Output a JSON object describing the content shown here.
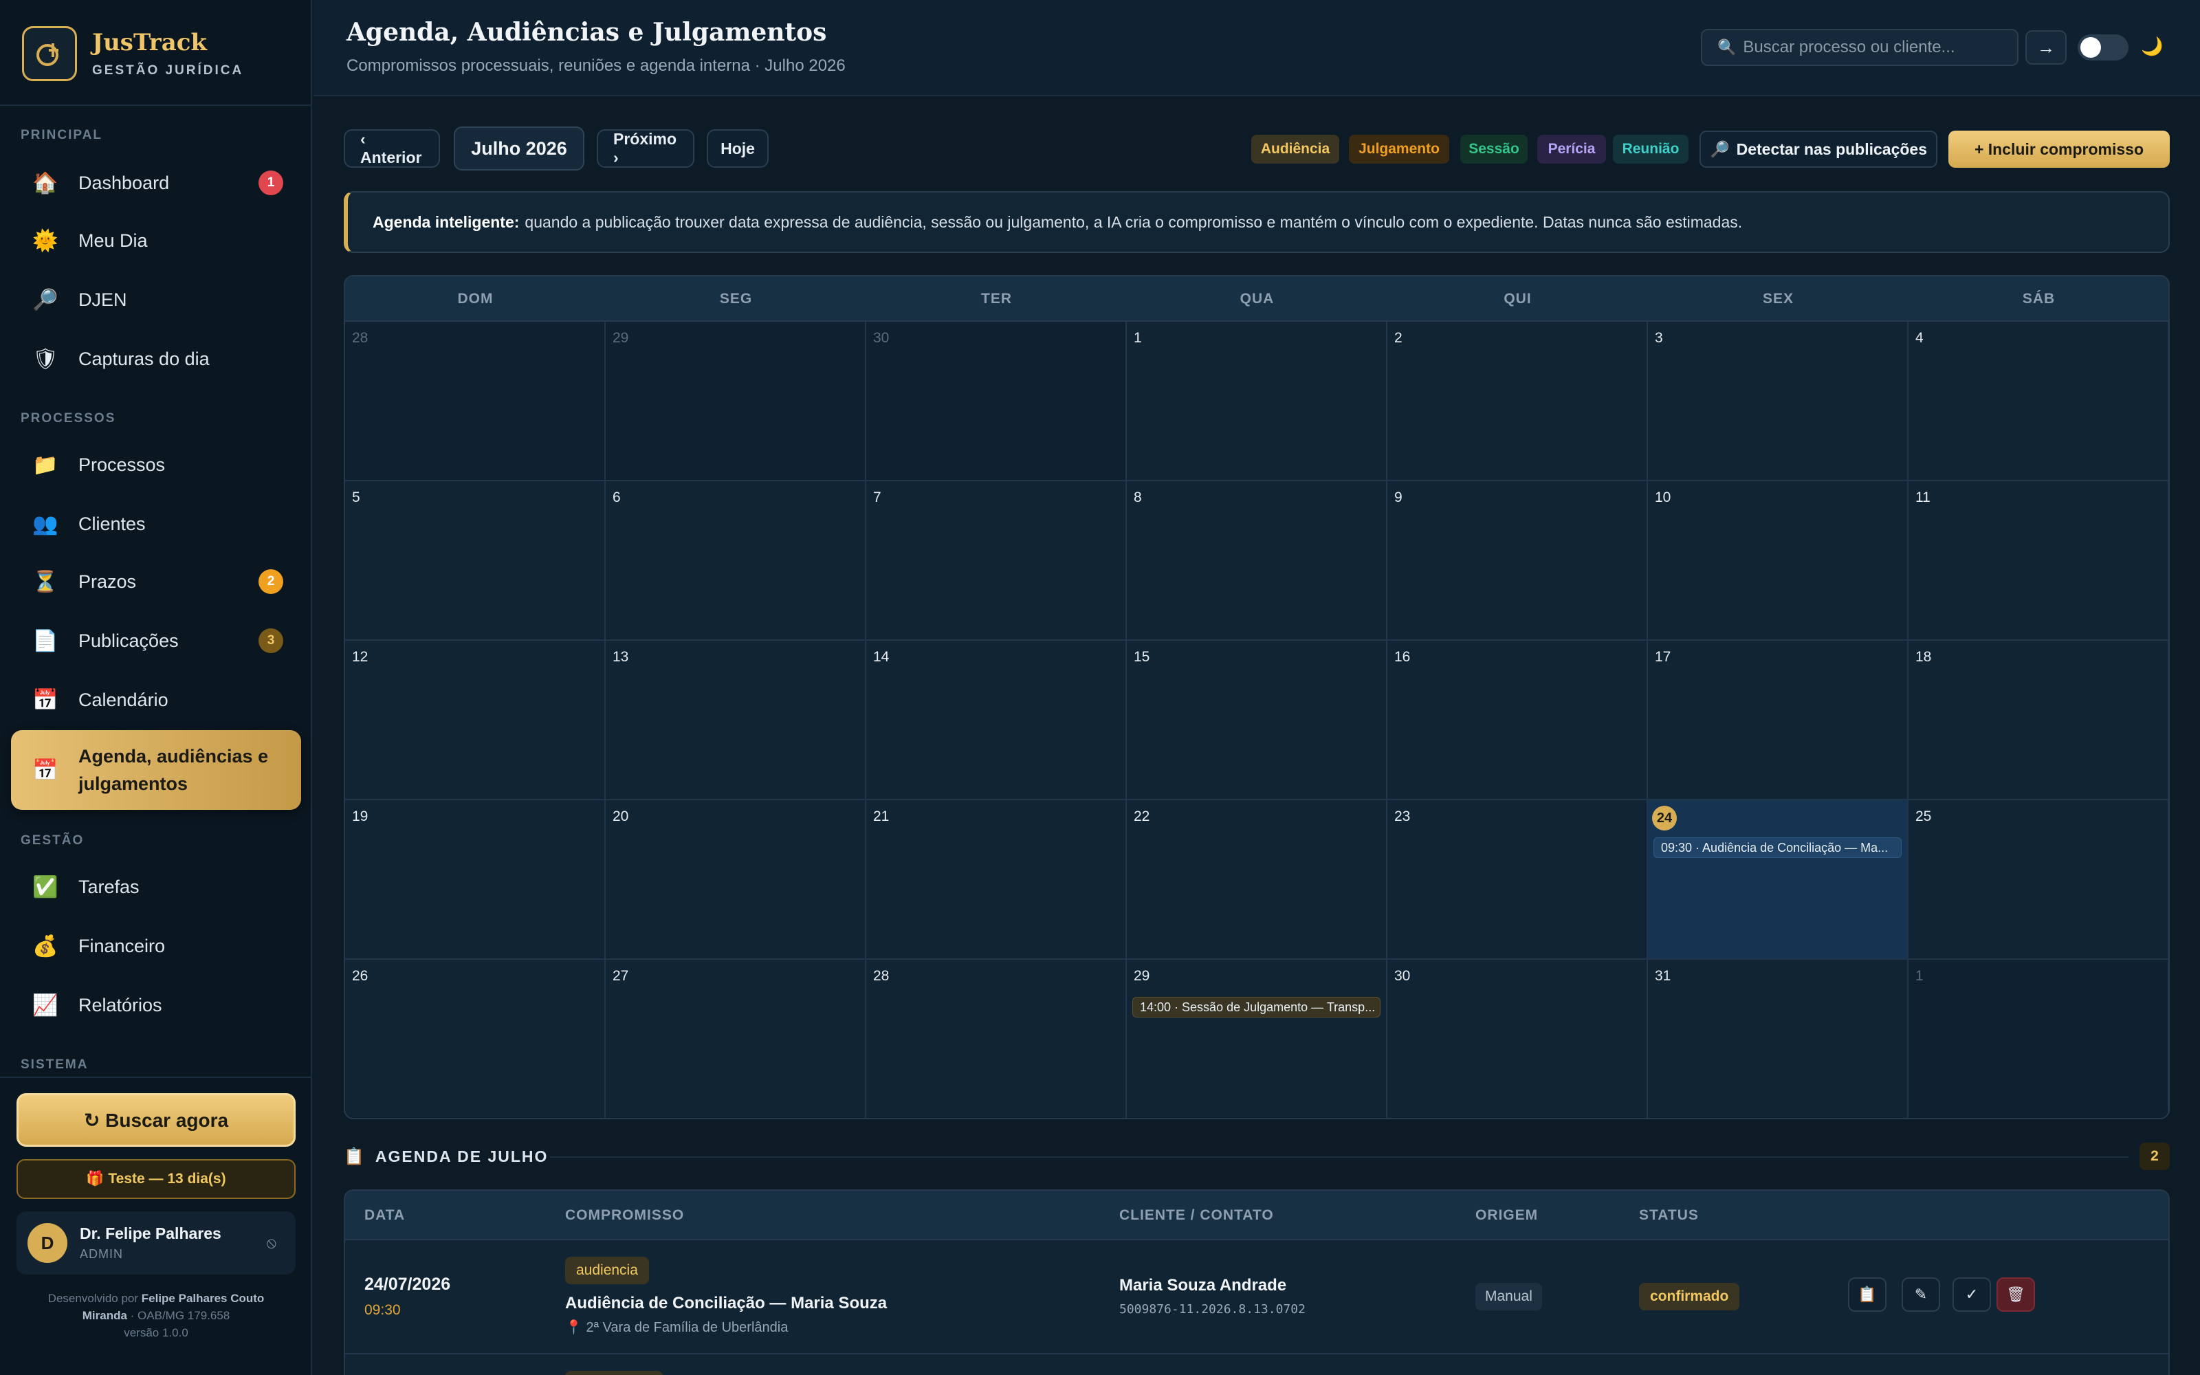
{
  "app": {
    "name": "JusTrack",
    "subtitle": "GESTÃO JURÍDICA"
  },
  "colors": {
    "accent_gold": "#d8ae55",
    "background": "#0d1b27",
    "sidebar": "#0a1620",
    "badge_red": "#e0474f",
    "badge_orange": "#f0a020"
  },
  "sidebar": {
    "sections": {
      "principal": "PRINCIPAL",
      "processos": "PROCESSOS",
      "gestao": "GESTÃO",
      "sistema": "SISTEMA"
    },
    "items": [
      {
        "label": "Dashboard",
        "icon": "home-icon",
        "badge": "1"
      },
      {
        "label": "Meu Dia",
        "icon": "sun-icon"
      },
      {
        "label": "DJEN",
        "icon": "magnifier-icon"
      },
      {
        "label": "Capturas do dia",
        "icon": "shield-icon"
      },
      {
        "label": "Processos",
        "icon": "folder-icon"
      },
      {
        "label": "Clientes",
        "icon": "users-icon"
      },
      {
        "label": "Prazos",
        "icon": "hourglass-icon",
        "badge": "2"
      },
      {
        "label": "Publicações",
        "icon": "document-icon",
        "badge": "3"
      },
      {
        "label": "Calendário",
        "icon": "calendar-icon"
      },
      {
        "label": "Agenda, audiências e julgamentos",
        "icon": "calendar-icon",
        "active": true
      },
      {
        "label": "Tarefas",
        "icon": "checkbox-icon"
      },
      {
        "label": "Financeiro",
        "icon": "money-bag-icon"
      },
      {
        "label": "Relatórios",
        "icon": "chart-icon"
      }
    ],
    "buscar_label": "↻ Buscar agora",
    "trial_label": "🎁 Teste — 13 dia(s)",
    "user": {
      "initial": "D",
      "name": "Dr. Felipe Palhares",
      "role": "ADMIN"
    },
    "credits": {
      "prefix": "Desenvolvido por",
      "author": "Felipe Palhares Couto Miranda",
      "oab": "· OAB/MG 179.658",
      "version": "versão 1.0.0"
    }
  },
  "header": {
    "title": "Agenda, Audiências e Julgamentos",
    "subtitle": "Compromissos processuais, reuniões e agenda interna · Julho 2026",
    "search_placeholder": "Buscar processo ou cliente...",
    "go_label": "→"
  },
  "toolbar": {
    "prev_label": "‹ Anterior",
    "month_label": "Julho 2026",
    "next_label": "Próximo ›",
    "today_label": "Hoje",
    "legend": [
      {
        "label": "Audiência",
        "bg": "#3a3523",
        "fg": "#f3c860"
      },
      {
        "label": "Julgamento",
        "bg": "#3a2a12",
        "fg": "#f0a020"
      },
      {
        "label": "Sessão",
        "bg": "#123428",
        "fg": "#35c48a"
      },
      {
        "label": "Perícia",
        "bg": "#2a2346",
        "fg": "#b8a4f5"
      },
      {
        "label": "Reunião",
        "bg": "#12343a",
        "fg": "#40d0c8"
      }
    ],
    "detect_label": "Detectar nas publicações",
    "add_label": "+ Incluir compromisso"
  },
  "banner": {
    "bold": "Agenda inteligente:",
    "text": "quando a publicação trouxer data expressa de audiência, sessão ou julgamento, a IA cria o compromisso e mantém o vínculo com o expediente. Datas nunca são estimadas."
  },
  "calendar": {
    "weekdays": [
      "DOM",
      "SEG",
      "TER",
      "QUA",
      "QUI",
      "SEX",
      "SÁB"
    ],
    "weeks": [
      [
        {
          "d": "28",
          "out": true
        },
        {
          "d": "29",
          "out": true
        },
        {
          "d": "30",
          "out": true
        },
        {
          "d": "1"
        },
        {
          "d": "2"
        },
        {
          "d": "3"
        },
        {
          "d": "4"
        }
      ],
      [
        {
          "d": "5"
        },
        {
          "d": "6"
        },
        {
          "d": "7"
        },
        {
          "d": "8"
        },
        {
          "d": "9"
        },
        {
          "d": "10"
        },
        {
          "d": "11"
        }
      ],
      [
        {
          "d": "12"
        },
        {
          "d": "13"
        },
        {
          "d": "14"
        },
        {
          "d": "15"
        },
        {
          "d": "16"
        },
        {
          "d": "17"
        },
        {
          "d": "18"
        }
      ],
      [
        {
          "d": "19"
        },
        {
          "d": "20"
        },
        {
          "d": "21"
        },
        {
          "d": "22"
        },
        {
          "d": "23"
        },
        {
          "d": "24",
          "today": true,
          "event": "09:30 · Audiência de Conciliação — Ma...",
          "event_style": "blue"
        },
        {
          "d": "25"
        }
      ],
      [
        {
          "d": "26"
        },
        {
          "d": "27"
        },
        {
          "d": "28"
        },
        {
          "d": "29",
          "event": "14:00 · Sessão de Julgamento — Transp...",
          "event_style": "olive"
        },
        {
          "d": "30"
        },
        {
          "d": "31"
        },
        {
          "d": "1",
          "out": true
        }
      ]
    ]
  },
  "agenda": {
    "title": "AGENDA DE JULHO",
    "count": "2",
    "columns": {
      "data": "DATA",
      "compromisso": "COMPROMISSO",
      "cliente": "CLIENTE / CONTATO",
      "origem": "ORIGEM",
      "status": "STATUS"
    },
    "rows": [
      {
        "date": "24/07/2026",
        "time": "09:30",
        "type": "audiencia",
        "title": "Audiência de Conciliação — Maria Souza",
        "location": "2ª Vara de Família de Uberlândia",
        "client": "Maria Souza Andrade",
        "process": "5009876-11.2026.8.13.0702",
        "origin": "Manual",
        "status": "confirmado"
      }
    ]
  }
}
